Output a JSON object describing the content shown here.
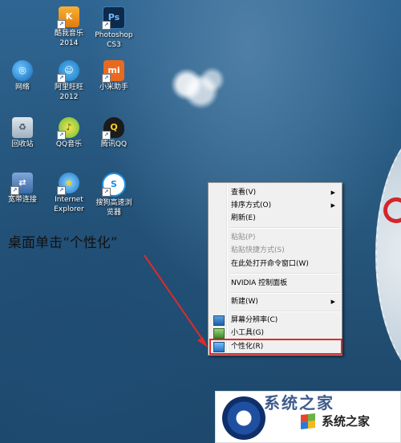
{
  "desktop_icons": [
    {
      "label": "酷我音乐\n2014",
      "icon": "kuwo-music-icon"
    },
    {
      "label": "Photoshop\nCS3",
      "icon": "photoshop-icon"
    },
    {
      "label": "网络",
      "icon": "network-icon"
    },
    {
      "label": "阿里旺旺\n2012",
      "icon": "aliwangwang-icon"
    },
    {
      "label": "小米助手",
      "icon": "mi-assistant-icon"
    },
    {
      "label": "回收站",
      "icon": "recycle-bin-icon"
    },
    {
      "label": "QQ音乐",
      "icon": "qq-music-icon"
    },
    {
      "label": "腾讯QQ",
      "icon": "tencent-qq-icon"
    },
    {
      "label": "宽带连接",
      "icon": "broadband-connection-icon"
    },
    {
      "label": "Internet\nExplorer",
      "icon": "internet-explorer-icon"
    },
    {
      "label": "搜狗高速浏\n览器",
      "icon": "sogou-browser-icon"
    }
  ],
  "instruction": "桌面单击“个性化”",
  "context_menu": {
    "items": [
      {
        "label": "查看(V)",
        "submenu": true,
        "enabled": true
      },
      {
        "label": "排序方式(O)",
        "submenu": true,
        "enabled": true
      },
      {
        "label": "刷新(E)",
        "submenu": false,
        "enabled": true
      },
      {
        "label": "粘贴(P)",
        "submenu": false,
        "enabled": false
      },
      {
        "label": "粘贴快捷方式(S)",
        "submenu": false,
        "enabled": false
      },
      {
        "label": "在此处打开命令窗口(W)",
        "submenu": false,
        "enabled": true
      },
      {
        "label": "NVIDIA 控制面板",
        "submenu": false,
        "enabled": true
      },
      {
        "label": "新建(W)",
        "submenu": true,
        "enabled": true
      },
      {
        "label": "屏幕分辨率(C)",
        "submenu": false,
        "enabled": true,
        "icon": "screen-resolution-icon"
      },
      {
        "label": "小工具(G)",
        "submenu": false,
        "enabled": true,
        "icon": "gadgets-icon"
      },
      {
        "label": "个性化(R)",
        "submenu": false,
        "enabled": true,
        "icon": "personalize-icon",
        "highlighted": true
      }
    ],
    "submenu_glyph": "▶"
  },
  "watermark": {
    "text": "系统之家",
    "big_text": "系统之家"
  },
  "colors": {
    "highlight_border": "#e02a2a",
    "arrow": "#e02a2a",
    "menu_bg": "#f0f0f0"
  }
}
